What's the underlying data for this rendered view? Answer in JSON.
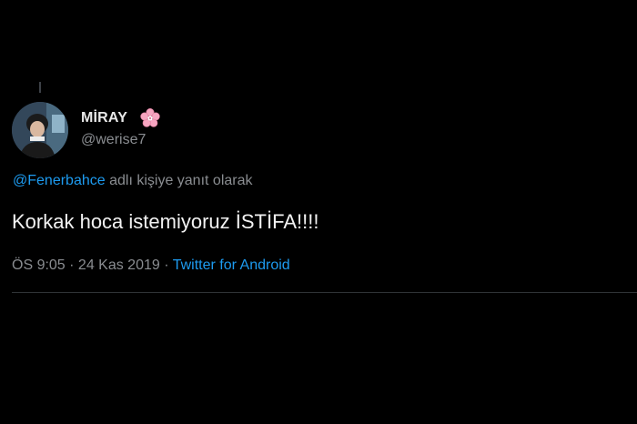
{
  "tweet": {
    "author": {
      "display_name": "MİRAY",
      "handle": "@werise7",
      "name_emoji": "cherry-blossom-icon"
    },
    "reply_to": {
      "mention": "@Fenerbahce",
      "suffix": " adlı kişiye yanıt olarak"
    },
    "text": "Korkak hoca istemiyoruz İSTİFA!!!!",
    "meta": {
      "time": "ÖS 9:05",
      "separator1": " · ",
      "date": "24 Kas 2019",
      "separator2": " · ",
      "source": "Twitter for Android"
    }
  },
  "colors": {
    "background": "#000000",
    "link": "#1d9bf0",
    "secondary_text": "#8a8d91",
    "primary_text": "#f2f2f2",
    "emoji_pink": "#f6a5c0"
  }
}
